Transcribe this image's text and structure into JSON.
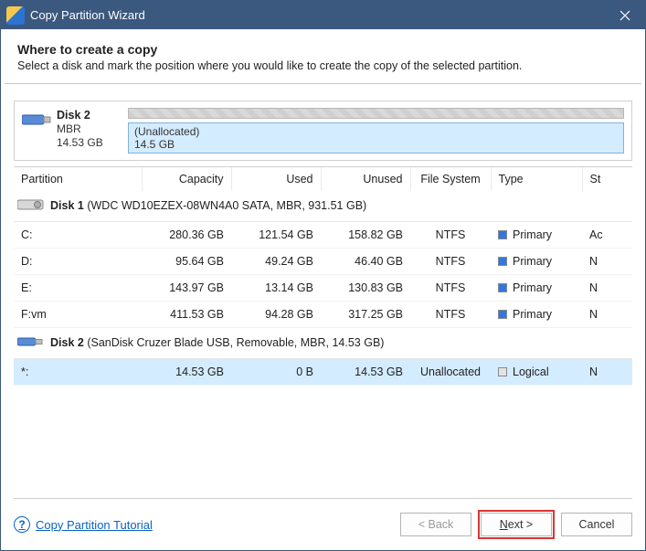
{
  "window": {
    "title": "Copy Partition Wizard"
  },
  "header": {
    "heading": "Where to create a copy",
    "subheading": "Select a disk and mark the position where you would like to create the copy of the selected partition."
  },
  "disk_pane": {
    "name": "Disk 2",
    "scheme": "MBR",
    "size": "14.53 GB",
    "segment_label": "(Unallocated)",
    "segment_size": "14.5 GB"
  },
  "table": {
    "columns": {
      "partition": "Partition",
      "capacity": "Capacity",
      "used": "Used",
      "unused": "Unused",
      "filesystem": "File System",
      "type": "Type",
      "status": "St"
    },
    "groups": [
      {
        "icon": "hdd",
        "name": "Disk 1",
        "desc": "(WDC WD10EZEX-08WN4A0 SATA, MBR, 931.51 GB)",
        "rows": [
          {
            "partition": "C:",
            "capacity": "280.36 GB",
            "used": "121.54 GB",
            "unused": "158.82 GB",
            "fs": "NTFS",
            "type": "Primary",
            "swatch": "blue",
            "status": "Ac"
          },
          {
            "partition": "D:",
            "capacity": "95.64 GB",
            "used": "49.24 GB",
            "unused": "46.40 GB",
            "fs": "NTFS",
            "type": "Primary",
            "swatch": "blue",
            "status": "N"
          },
          {
            "partition": "E:",
            "capacity": "143.97 GB",
            "used": "13.14 GB",
            "unused": "130.83 GB",
            "fs": "NTFS",
            "type": "Primary",
            "swatch": "blue",
            "status": "N"
          },
          {
            "partition": "F:vm",
            "capacity": "411.53 GB",
            "used": "94.28 GB",
            "unused": "317.25 GB",
            "fs": "NTFS",
            "type": "Primary",
            "swatch": "blue",
            "status": "N"
          }
        ]
      },
      {
        "icon": "usb",
        "name": "Disk 2",
        "desc": "(SanDisk Cruzer Blade USB, Removable, MBR, 14.53 GB)",
        "rows": [
          {
            "partition": "*:",
            "capacity": "14.53 GB",
            "used": "0 B",
            "unused": "14.53 GB",
            "fs": "Unallocated",
            "type": "Logical",
            "swatch": "grey",
            "status": "N",
            "selected": true
          }
        ]
      }
    ]
  },
  "footer": {
    "help": "Copy Partition Tutorial",
    "back": "< Back",
    "next_prefix": "N",
    "next_rest": "ext >",
    "cancel": "Cancel"
  }
}
